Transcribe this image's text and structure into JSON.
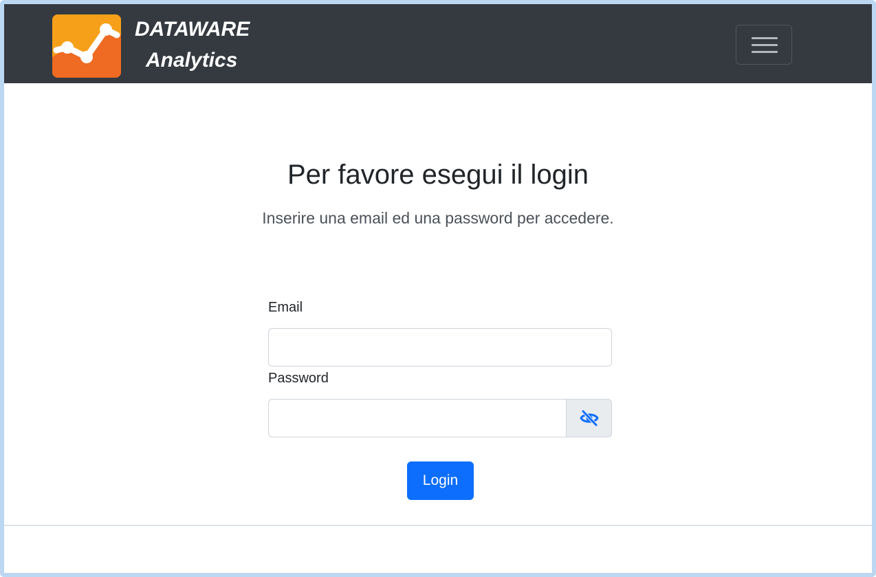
{
  "navbar": {
    "brand_line1": "DATAWARE",
    "brand_line2": "Analytics",
    "logo_icon": "line-chart-logo-icon",
    "menu_icon": "hamburger-menu-icon",
    "background_color": "#343a40",
    "logo_color": "#ef6a22"
  },
  "main": {
    "title": "Per favore esegui il login",
    "subtitle": "Inserire una email ed una password per accedere."
  },
  "form": {
    "email_label": "Email",
    "email_value": "",
    "password_label": "Password",
    "password_value": "",
    "toggle_icon": "eye-slash-icon",
    "login_label": "Login",
    "accent_color": "#0d6efd"
  }
}
